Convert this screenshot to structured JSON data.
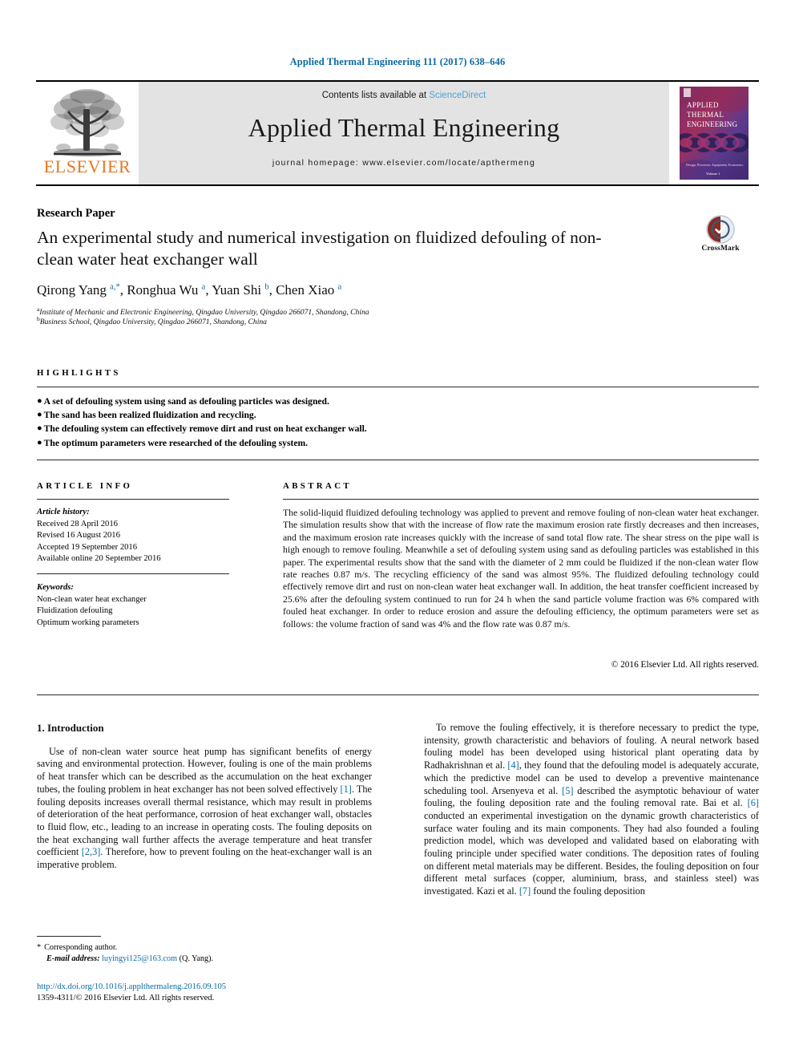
{
  "running_head": "Applied Thermal Engineering 111 (2017) 638–646",
  "journal_header": {
    "contents_prefix": "Contents lists available at ",
    "sciencedirect": "ScienceDirect",
    "journal_title": "Applied Thermal Engineering",
    "homepage": "journal homepage: www.elsevier.com/locate/apthermeng",
    "publisher": "ELSEVIER",
    "publisher_logo_icon": "elsevier-tree-logo",
    "cover_icon": "journal-cover-thumbnail",
    "cover_title_lines": [
      "APPLIED",
      "THERMAL",
      "ENGINEERING"
    ],
    "cover_subtitle": "Design, Processes, Equipment, Economics",
    "band_color": "#e3e3e3",
    "link_color": "#4ea0d8",
    "publisher_color": "#e87722"
  },
  "article": {
    "type": "Research Paper",
    "title": "An experimental study and numerical investigation on fluidized defouling of non-clean water heat exchanger wall",
    "crossmark_label": "CrossMark",
    "crossmark_icon": "crossmark-badge-icon",
    "authors": [
      {
        "name": "Qirong Yang",
        "sup": "a,*"
      },
      {
        "name": "Ronghua Wu",
        "sup": "a"
      },
      {
        "name": "Yuan Shi",
        "sup": "b"
      },
      {
        "name": "Chen Xiao",
        "sup": "a"
      }
    ],
    "affiliations": [
      {
        "sup": "a",
        "text": "Institute of Mechanic and Electronic Engineering, Qingdao University, Qingdao 266071, Shandong, China"
      },
      {
        "sup": "b",
        "text": "Business School, Qingdao University, Qingdao 266071, Shandong, China"
      }
    ]
  },
  "highlights": {
    "heading": "HIGHLIGHTS",
    "items": [
      "A set of defouling system using sand as defouling particles was designed.",
      "The sand has been realized fluidization and recycling.",
      "The defouling system can effectively remove dirt and rust on heat exchanger wall.",
      "The optimum parameters were researched of the defouling system."
    ]
  },
  "article_info": {
    "heading": "ARTICLE INFO",
    "history_label": "Article history:",
    "history": [
      "Received 28 April 2016",
      "Revised 16 August 2016",
      "Accepted 19 September 2016",
      "Available online 20 September 2016"
    ],
    "keywords_label": "Keywords:",
    "keywords": [
      "Non-clean water heat exchanger",
      "Fluidization defouling",
      "Optimum working parameters"
    ]
  },
  "abstract": {
    "heading": "ABSTRACT",
    "text": "The solid-liquid fluidized defouling technology was applied to prevent and remove fouling of non-clean water heat exchanger. The simulation results show that with the increase of flow rate the maximum erosion rate firstly decreases and then increases, and the maximum erosion rate increases quickly with the increase of sand total flow rate. The shear stress on the pipe wall is high enough to remove fouling. Meanwhile a set of defouling system using sand as defouling particles was established in this paper. The experimental results show that the sand with the diameter of 2 mm could be fluidized if the non-clean water flow rate reaches 0.87 m/s. The recycling efficiency of the sand was almost 95%. The fluidized defouling technology could effectively remove dirt and rust on non-clean water heat exchanger wall. In addition, the heat transfer coefficient increased by 25.6% after the defouling system continued to run for 24 h when the sand particle volume fraction was 6% compared with fouled heat exchanger. In order to reduce erosion and assure the defouling efficiency, the optimum parameters were set as follows: the volume fraction of sand was 4% and the flow rate was 0.87 m/s.",
    "copyright": "© 2016 Elsevier Ltd. All rights reserved."
  },
  "body": {
    "section_heading": "1. Introduction",
    "left_paragraphs": [
      "Use of non-clean water source heat pump has significant benefits of energy saving and environmental protection. However, fouling is one of the main problems of heat transfer which can be described as the accumulation on the heat exchanger tubes, the fouling problem in heat exchanger has not been solved effectively [1]. The fouling deposits increases overall thermal resistance, which may result in problems of deterioration of the heat performance, corrosion of heat exchanger wall, obstacles to fluid flow, etc., leading to an increase in operating costs. The fouling deposits on the heat exchanging wall further affects the average temperature and heat transfer coefficient [2,3]. Therefore, how to prevent fouling on the heat-exchanger wall is an imperative problem."
    ],
    "right_paragraphs": [
      "To remove the fouling effectively, it is therefore necessary to predict the type, intensity, growth characteristic and behaviors of fouling. A neural network based fouling model has been developed using historical plant operating data by Radhakrishnan et al. [4], they found that the defouling model is adequately accurate, which the predictive model can be used to develop a preventive maintenance scheduling tool. Arsenyeva et al. [5] described the asymptotic behaviour of water fouling, the fouling deposition rate and the fouling removal rate. Bai et al. [6] conducted an experimental investigation on the dynamic growth characteristics of surface water fouling and its main components. They had also founded a fouling prediction model, which was developed and validated based on elaborating with fouling principle under specified water conditions. The deposition rates of fouling on different metal materials may be different. Besides, the fouling deposition on four different metal surfaces (copper, aluminium, brass, and stainless steel) was investigated. Kazi et al. [7] found the fouling deposition"
    ],
    "citation_color": "#0b6aa2"
  },
  "footnote": {
    "star": "*",
    "corresponding": "Corresponding author.",
    "email_label": "E-mail address:",
    "email": "luyingyi125@163.com",
    "email_owner": "(Q. Yang)."
  },
  "footer": {
    "doi": "http://dx.doi.org/10.1016/j.applthermaleng.2016.09.105",
    "issn_line": "1359-4311/© 2016 Elsevier Ltd. All rights reserved."
  }
}
